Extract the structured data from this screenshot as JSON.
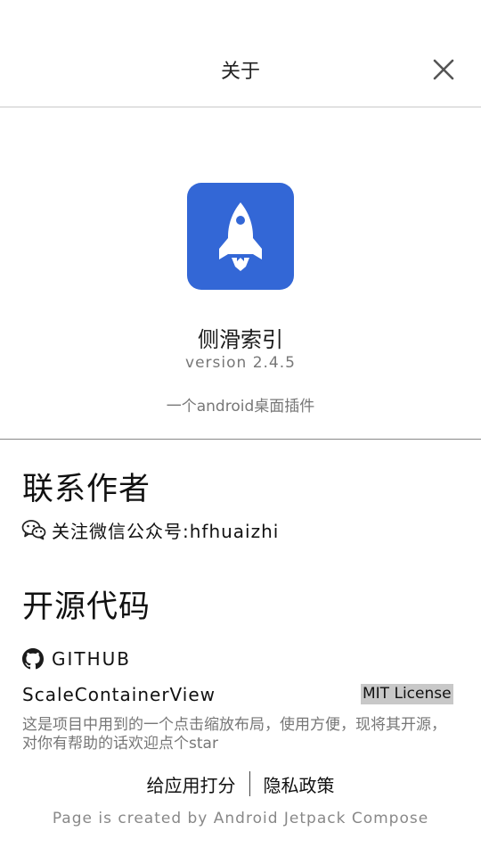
{
  "header": {
    "title": "关于",
    "close_icon": "close-icon"
  },
  "app": {
    "icon": "rocket-icon",
    "icon_bg_color": "#3367d6",
    "name": "侧滑索引",
    "version": "version 2.4.5",
    "description": "一个android桌面插件"
  },
  "contact": {
    "section_title": "联系作者",
    "icon": "wechat-icon",
    "text": "关注微信公众号:hfhuaizhi"
  },
  "source": {
    "section_title": "开源代码",
    "github_icon": "github-icon",
    "github_label": "GITHUB",
    "repo_name": "ScaleContainerView",
    "license": "MIT License",
    "repo_description": "这是项目中用到的一个点击缩放布局，使用方便，现将其开源，对你有帮助的话欢迎点个star"
  },
  "footer": {
    "rate_label": "给应用打分",
    "privacy_label": "隐私政策",
    "note": "Page is created by Android Jetpack Compose"
  }
}
